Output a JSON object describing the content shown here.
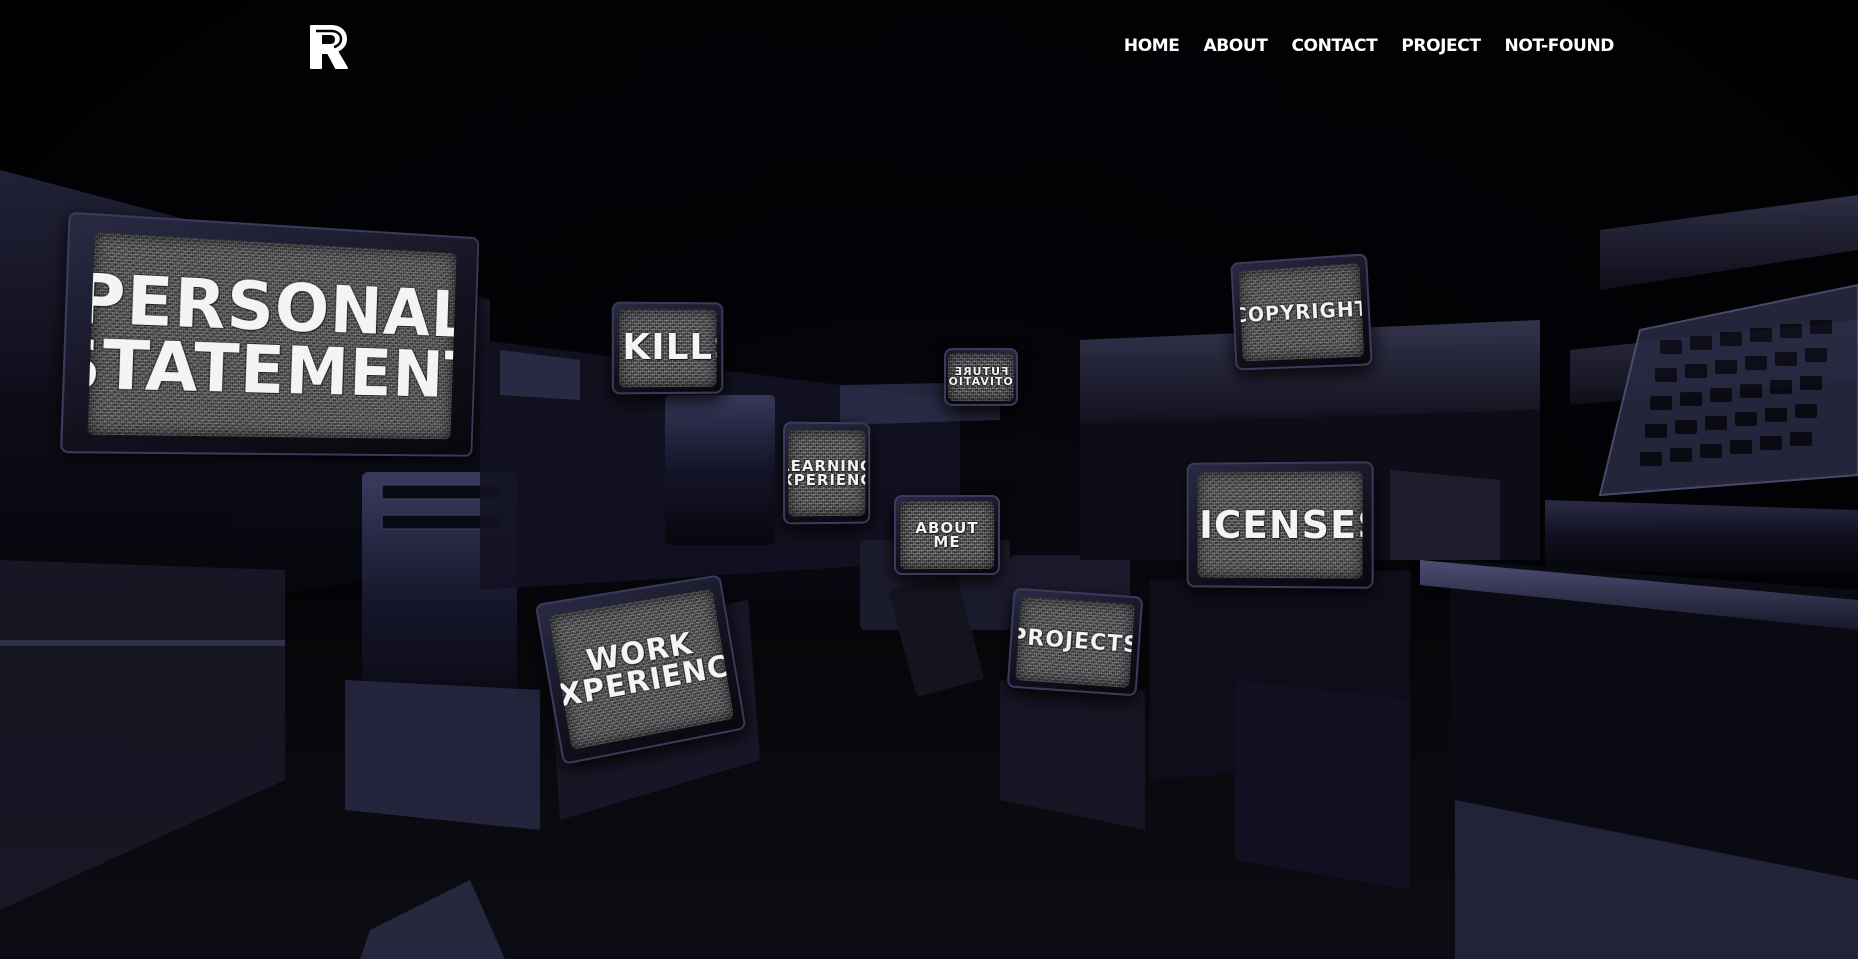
{
  "header": {
    "logo_letter": "R",
    "nav": [
      "HOME",
      "ABOUT",
      "CONTACT",
      "PROJECT",
      "NOT-FOUND"
    ]
  },
  "scene": {
    "monitors": {
      "personal_statement": "PERSONAL\nSTATEMENT",
      "skills": "SKILLS",
      "future_motivation": "FUTURE\nMOTIVATION",
      "copyright": "COPYRIGHT",
      "learning_experience": "LEARNING\nEXPERIENCE",
      "about_me": "ABOUT ME",
      "licenses": "LICENSES",
      "work_experience": "WORK\nEXPERIENCE",
      "projects": "PROJECTS"
    }
  },
  "colors": {
    "background": "#020205",
    "hardware_tint": "#4a4a78",
    "nav_text": "#ffffff"
  }
}
